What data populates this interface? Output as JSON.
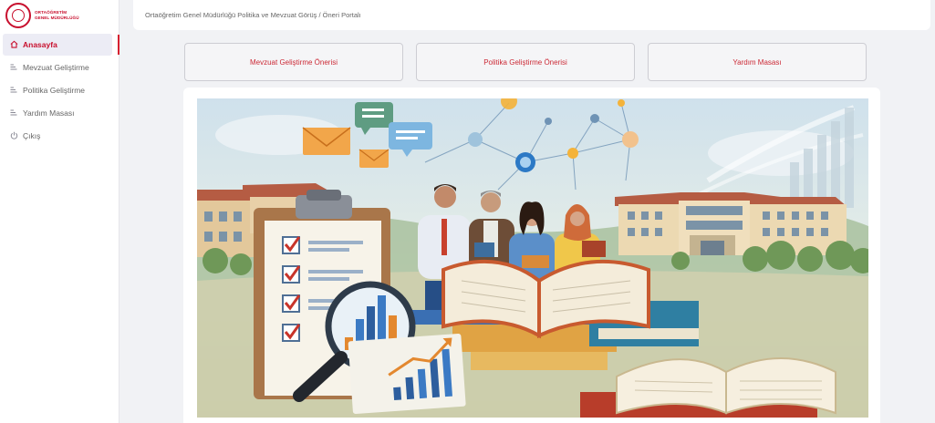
{
  "brand": {
    "logo_line1": "ORTAÖĞRETİM",
    "logo_line2": "GENEL MÜDÜRLÜĞÜ",
    "accent_color": "#c8102e"
  },
  "sidebar": {
    "items": [
      {
        "label": "Anasayfa",
        "icon": "home-icon",
        "active": true
      },
      {
        "label": "Mevzuat Geliştirme",
        "icon": "document-icon",
        "active": false
      },
      {
        "label": "Politika Geliştirme",
        "icon": "document-icon",
        "active": false
      },
      {
        "label": "Yardım Masası",
        "icon": "document-icon",
        "active": false
      },
      {
        "label": "Çıkış",
        "icon": "power-icon",
        "active": false
      }
    ]
  },
  "header": {
    "breadcrumb": "Ortaöğretim Genel Müdürlüğü Politika ve Mevzuat Görüş / Öneri Portalı"
  },
  "actions": [
    {
      "label": "Mevzuat Geliştirme Önerisi"
    },
    {
      "label": "Politika Geliştirme Önerisi"
    },
    {
      "label": "Yardım Masası"
    }
  ]
}
